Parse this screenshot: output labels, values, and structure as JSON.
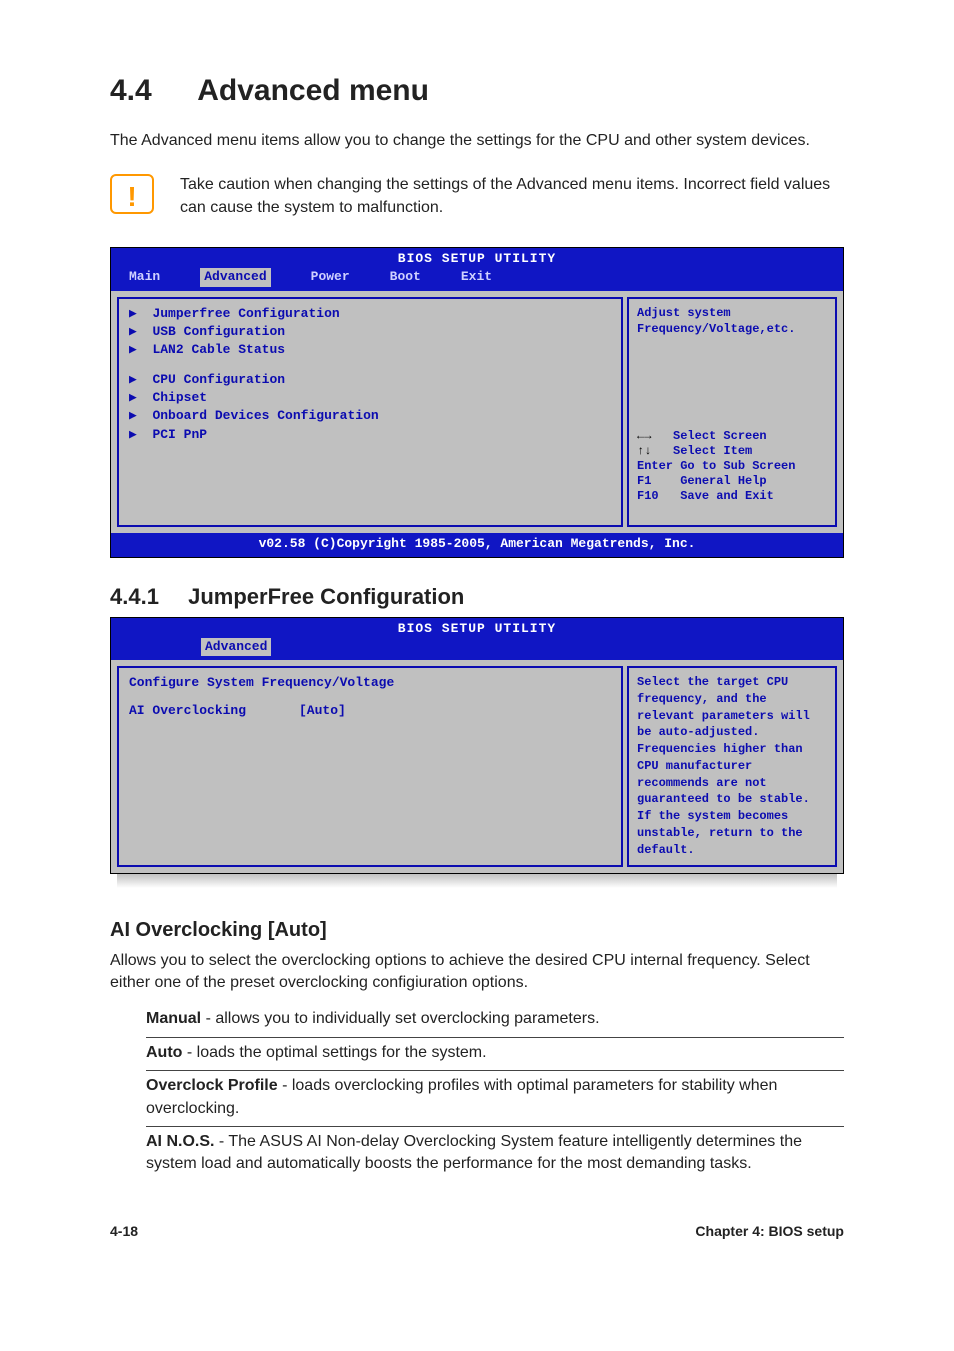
{
  "section": {
    "number": "4.4",
    "title": "Advanced menu"
  },
  "intro": "The Advanced menu items allow you to change the settings for the CPU and other system devices.",
  "callout": "Take caution when changing the settings of the Advanced menu items. Incorrect field values can cause the system to malfunction.",
  "bios1": {
    "title": "BIOS SETUP UTILITY",
    "tabs": [
      "Main",
      "Advanced",
      "Power",
      "Boot",
      "Exit"
    ],
    "selected_tab": "Advanced",
    "left_group1": [
      "Jumperfree Configuration",
      "USB Configuration",
      "LAN2 Cable Status"
    ],
    "left_group2": [
      "CPU Configuration",
      "Chipset",
      "Onboard Devices Configuration",
      "PCI PnP"
    ],
    "right_help_top": "Adjust system Frequency/Voltage,etc.",
    "right_help_keys": [
      {
        "sym": "←→",
        "txt": "Select Screen"
      },
      {
        "sym": "↑↓",
        "txt": "Select Item"
      },
      {
        "sym": "Enter",
        "txt": "Go to Sub Screen"
      },
      {
        "sym": "F1",
        "txt": "General Help"
      },
      {
        "sym": "F10",
        "txt": "Save and Exit"
      }
    ],
    "footer": "v02.58 (C)Copyright 1985-2005, American Megatrends, Inc."
  },
  "subsection": {
    "number": "4.4.1",
    "title": "JumperFree Configuration"
  },
  "bios2": {
    "title": "BIOS SETUP UTILITY",
    "tab": "Advanced",
    "panel_heading": "Configure System Frequency/Voltage",
    "row": {
      "label": "AI Overclocking",
      "value": "[Auto]"
    },
    "right_help": "Select the target CPU frequency, and the relevant parameters will be auto-adjusted. Frequencies higher than CPU manufacturer recommends are not guaranteed to be stable. If the system becomes unstable, return to the default."
  },
  "option": {
    "title": "AI Overclocking [Auto]",
    "desc": "Allows you to select the overclocking options to achieve the desired CPU internal frequency. Select either one of the preset overclocking configiuration options.",
    "items": [
      {
        "name": "Manual",
        "desc": " - allows you to individually set overclocking parameters."
      },
      {
        "name": "Auto",
        "desc": " - loads the optimal settings for the system."
      },
      {
        "name": "Overclock Profile",
        "desc": " - loads overclocking profiles with optimal parameters for stability when overclocking."
      },
      {
        "name": "AI N.O.S.",
        "desc": " - The ASUS AI Non-delay Overclocking System feature intelligently determines the system load and automatically boosts the performance for the most demanding tasks."
      }
    ]
  },
  "footer": {
    "left": "4-18",
    "right": "Chapter 4: BIOS setup"
  }
}
